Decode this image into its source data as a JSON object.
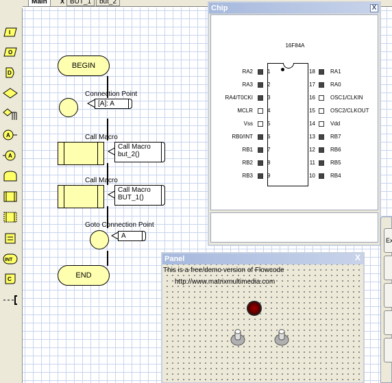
{
  "tabs": [
    {
      "label": "Main",
      "active": true
    },
    {
      "label": "BUT_1",
      "active": false
    },
    {
      "label": "but_2",
      "active": false
    }
  ],
  "toolbar": {
    "icons": [
      "input-icon",
      "output-icon",
      "delay-icon",
      "decision-icon",
      "switch-icon",
      "calculation-icon",
      "connection-point-icon",
      "loop-icon",
      "macro-icon",
      "component-macro-icon",
      "code-icon",
      "interrupt-icon",
      "comment-icon",
      "stop-icon"
    ],
    "labels": [
      "I",
      "O",
      "D",
      "",
      "",
      "A",
      "A",
      "",
      "",
      "",
      "",
      "INT",
      "C",
      ""
    ]
  },
  "flowchart": {
    "begin_label": "BEGIN",
    "end_label": "END",
    "connection_point": {
      "title": "Connection Point",
      "callout": "[A]: A"
    },
    "call_macro_1": {
      "title": "Call Macro",
      "callout_line1": "Call Macro",
      "callout_line2": "but_2()"
    },
    "call_macro_2": {
      "title": "Call Macro",
      "callout_line1": "Call Macro",
      "callout_line2": "BUT_1()"
    },
    "goto": {
      "title": "Goto Connection Point",
      "callout": "A"
    }
  },
  "chip_window": {
    "title": "Chip",
    "chip_name": "16F84A",
    "pins_left": [
      {
        "label": "RA2",
        "num": "1",
        "filled": true
      },
      {
        "label": "RA3",
        "num": "2",
        "filled": true
      },
      {
        "label": "RA4/T0CKI",
        "num": "3",
        "filled": true
      },
      {
        "label": "MCLR",
        "num": "4",
        "filled": false
      },
      {
        "label": "Vss",
        "num": "5",
        "filled": false
      },
      {
        "label": "RB0/INT",
        "num": "6",
        "filled": true
      },
      {
        "label": "RB1",
        "num": "7",
        "filled": true
      },
      {
        "label": "RB2",
        "num": "8",
        "filled": true
      },
      {
        "label": "RB3",
        "num": "9",
        "filled": true
      }
    ],
    "pins_right": [
      {
        "label": "RA1",
        "num": "18",
        "filled": true
      },
      {
        "label": "RA0",
        "num": "17",
        "filled": true
      },
      {
        "label": "OSC1/CLKIN",
        "num": "16",
        "filled": false
      },
      {
        "label": "OSC2/CLKOUT",
        "num": "15",
        "filled": false
      },
      {
        "label": "Vdd",
        "num": "14",
        "filled": false
      },
      {
        "label": "RB7",
        "num": "13",
        "filled": true
      },
      {
        "label": "RB6",
        "num": "12",
        "filled": true
      },
      {
        "label": "RB5",
        "num": "11",
        "filled": true
      },
      {
        "label": "RB4",
        "num": "10",
        "filled": true
      }
    ]
  },
  "panel_window": {
    "title": "Panel",
    "line1": "This is a free/demo version of Flowcode",
    "line2": "http://www.matrixmultimedia.com"
  },
  "right_fragment": {
    "labels": [
      "Ex",
      "",
      "",
      ""
    ]
  },
  "close_glyph": "X",
  "tab_close_glyph": "X"
}
